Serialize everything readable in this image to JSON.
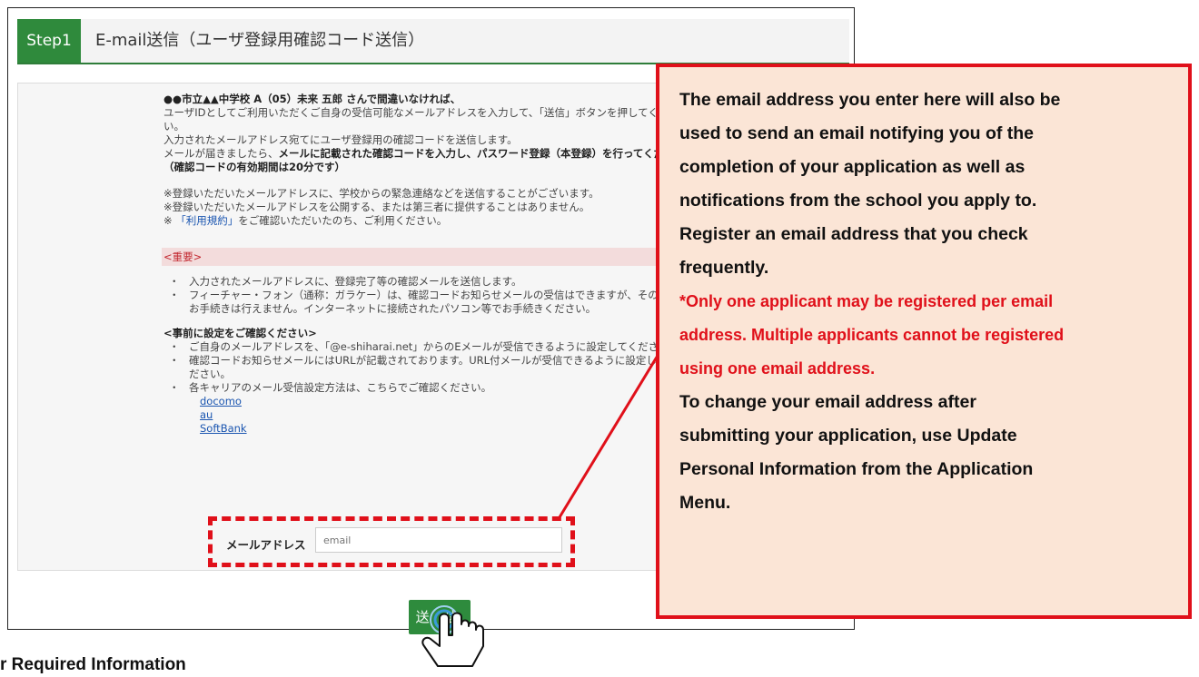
{
  "step": {
    "badge": "Step1",
    "title": "E-mail送信（ユーザ登録用確認コード送信）"
  },
  "intro": {
    "line1": "●●市立▲▲中学校  A（05）未来 五郎 さんで間違いなければ、",
    "line2": "ユーザIDとしてご利用いただくご自身の受信可能なメールアドレスを入力して、「送信」ボタンを押してく",
    "line3": "い。",
    "line4": "入力されたメールアドレス宛てにユーザ登録用の確認コードを送信します。",
    "line5_a": "メールが届きましたら、",
    "line5_b": "メールに記載された確認コードを入力し、パスワード登録（本登録）を行ってくだ",
    "line6": "（確認コードの有効期間は20分です）"
  },
  "notes": {
    "n1": "※登録いただいたメールアドレスに、学校からの緊急連絡などを送信することがございます。",
    "n2": "※登録いただいたメールアドレスを公開する、または第三者に提供することはありません。",
    "n3_prefix": "※",
    "n3_link": "「利用規約」",
    "n3_suffix": "をご確認いただいたのち、ご利用ください。"
  },
  "important": {
    "label": "<重要>",
    "b1": "入力されたメールアドレスに、登録完了等の確認メールを送信します。",
    "b2_a": "フィーチャー・フォン（通称：ガラケー）は、確認コードお知らせメールの受信はできますが、その後",
    "b2_b": "お手続きは行えません。インターネットに接続されたパソコン等でお手続きください。"
  },
  "presettings": {
    "heading": "<事前に設定をご確認ください>",
    "b1": "ご自身のメールアドレスを、「@e-shiharai.net」からのEメールが受信できるように設定してください",
    "b2_a": "確認コードお知らせメールにはURLが記載されております。URL付メールが受信できるように設定して",
    "b2_b": "ださい。",
    "b3": "各キャリアのメール受信設定方法は、こちらでご確認ください。",
    "links": [
      "docomo",
      "au",
      "SoftBank"
    ]
  },
  "form": {
    "email_label": "メールアドレス",
    "email_placeholder": "email",
    "email_value": ""
  },
  "send_button": "送 信",
  "callout": {
    "main_lines": [
      "The email address you enter here will also be",
      "used to send an email notifying you of the",
      "completion of your application as well as",
      "notifications from the school you apply to.",
      "Register an email address that you check",
      "frequently."
    ],
    "red_lines": [
      "*Only one applicant may be registered per email",
      "address. Multiple applicants cannot be registered",
      "using one email address."
    ],
    "tail_lines": [
      "To change your email address after",
      "submitting your application, use Update",
      "Personal Information from the Application",
      "Menu."
    ]
  },
  "bottom_heading": "r Required Information",
  "colors": {
    "accent_green": "#2f8a3c",
    "callout_border": "#e0101a",
    "callout_bg": "#fbe5d6",
    "important_bg": "#f3dcdc"
  },
  "icons": [
    "hand-pointer-icon"
  ]
}
